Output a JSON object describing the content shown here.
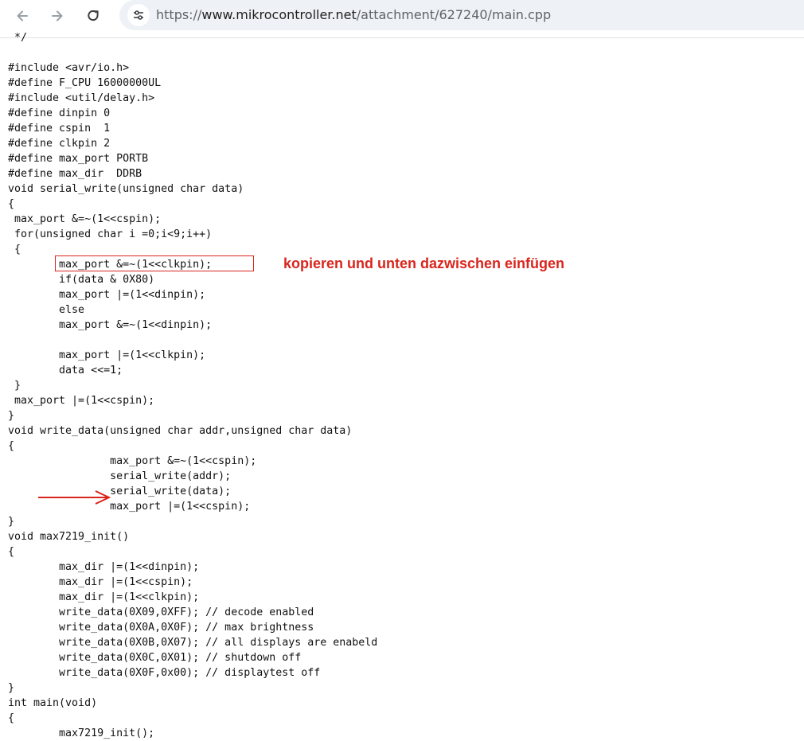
{
  "browser": {
    "url_scheme": "https://",
    "url_host": "www.mikrocontroller.net",
    "url_path": "/attachment/627240/main.cpp"
  },
  "code_lines": [
    " */",
    "",
    "#include <avr/io.h>",
    "#define F_CPU 16000000UL",
    "#include <util/delay.h>",
    "#define dinpin 0",
    "#define cspin  1",
    "#define clkpin 2",
    "#define max_port PORTB",
    "#define max_dir  DDRB",
    "void serial_write(unsigned char data)",
    "{",
    " max_port &=~(1<<cspin);",
    " for(unsigned char i =0;i<9;i++)",
    " {",
    "        max_port &=~(1<<clkpin);",
    "        if(data & 0X80)",
    "        max_port |=(1<<dinpin);",
    "        else",
    "        max_port &=~(1<<dinpin);",
    "",
    "        max_port |=(1<<clkpin);",
    "        data <<=1;",
    " }",
    " max_port |=(1<<cspin);",
    "}",
    "void write_data(unsigned char addr,unsigned char data)",
    "{",
    "                max_port &=~(1<<cspin);",
    "                serial_write(addr);",
    "                serial_write(data);",
    "                max_port |=(1<<cspin);",
    "}",
    "void max7219_init()",
    "{",
    "        max_dir |=(1<<dinpin);",
    "        max_dir |=(1<<cspin);",
    "        max_dir |=(1<<clkpin);",
    "        write_data(0X09,0XFF); // decode enabled",
    "        write_data(0X0A,0X0F); // max brightness",
    "        write_data(0X0B,0X07); // all displays are enabeld",
    "        write_data(0X0C,0X01); // shutdown off",
    "        write_data(0X0F,0x00); // displaytest off",
    "}",
    "int main(void)",
    "{",
    "        max7219_init();"
  ],
  "annotation": {
    "text": "kopieren und unten dazwischen einfügen",
    "color": "#d9251d"
  },
  "icons": {
    "back": "arrow-left-icon",
    "forward": "arrow-right-icon",
    "reload": "reload-icon",
    "site_info": "tune-icon"
  }
}
